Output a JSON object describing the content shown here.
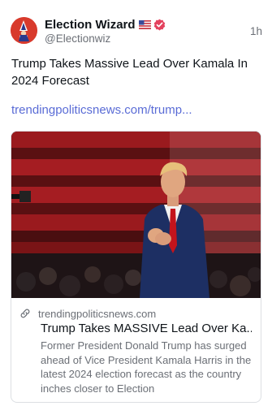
{
  "post": {
    "author_name": "Election Wizard",
    "flag_icon": "us-flag-icon",
    "verified_icon": "verified-badge-icon",
    "handle": "@Electionwiz",
    "time": "1h",
    "text": "Trump Takes Massive Lead Over Kamala In 2024 Forecast",
    "link_text": "trendingpoliticsnews.com/trump..."
  },
  "card": {
    "domain_icon": "link-icon",
    "domain": "trendingpoliticsnews.com",
    "title": "Trump Takes MASSIVE Lead Over Ka...",
    "description": "Former President Donald Trump has surged ahead of Vice President Kamala Harris in the latest 2024 election forecast as the country inches closer to Election"
  },
  "colors": {
    "link": "#5a6cd6",
    "muted_text": "#6b6f76",
    "verified_badge": "#e4425e",
    "avatar_bg": "#d83a2c"
  }
}
